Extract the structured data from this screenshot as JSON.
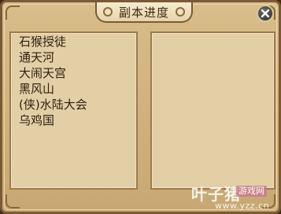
{
  "window": {
    "title": "副本进度",
    "close_icon": "close-icon"
  },
  "dungeon_list": [
    "石猴授徒",
    "通天河",
    "大闹天宫",
    "黑风山",
    "(侠)水陆大会",
    "乌鸡国"
  ],
  "watermark": {
    "brand": "叶子猪",
    "box_text": "游戏网",
    "url": "www.yzz.cn"
  },
  "colors": {
    "frame": "#7a5a34",
    "panel": "#e3cfa6",
    "text": "#2c1f10"
  }
}
